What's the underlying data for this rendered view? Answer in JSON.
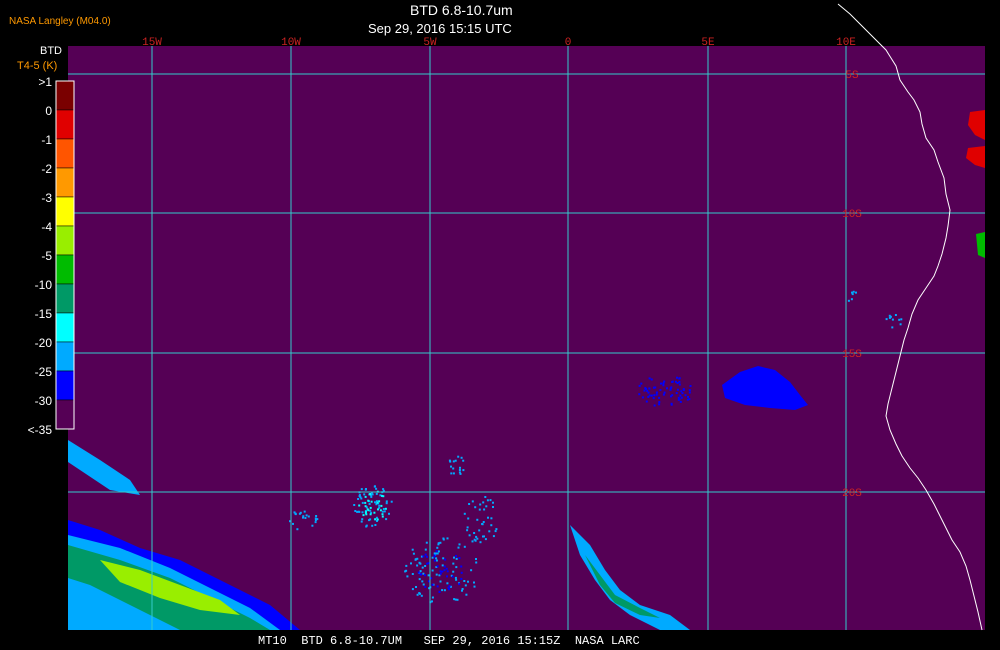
{
  "header": {
    "producer": "NASA Langley (M04.0)",
    "title": "BTD 6.8-10.7um",
    "datetime": "Sep 29, 2016 15:15 UTC"
  },
  "footer": {
    "text": "MT10  BTD 6.8-10.7UM   SEP 29, 2016 15:15Z  NASA LARC"
  },
  "legend": {
    "title": "BTD",
    "units": "T4-5 (K)",
    "labels": [
      ">1",
      "0",
      "-1",
      "-2",
      "-3",
      "-4",
      "-5",
      "-10",
      "-15",
      "-20",
      "-25",
      "-30",
      "<-35"
    ],
    "colors": [
      "#7a0000",
      "#e00000",
      "#ff5500",
      "#ff9900",
      "#ffff00",
      "#99ee00",
      "#00bb00",
      "#009966",
      "#00ffff",
      "#00aaff",
      "#0000ff",
      "#550055"
    ]
  },
  "map": {
    "background_color": "#550055",
    "grid_color": "#33cccc",
    "longitude_labels": [
      "15W",
      "10W",
      "5W",
      "0",
      "5E",
      "10E"
    ],
    "latitude_labels": [
      "5S",
      "10S",
      "15S",
      "20S"
    ],
    "label_color": "#cc2222"
  }
}
